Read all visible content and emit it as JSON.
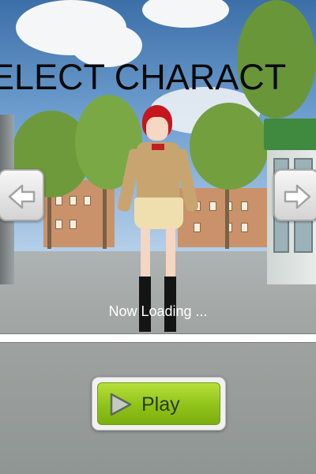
{
  "screen": {
    "title": "ELECT CHARACT",
    "status_text": "Now Loading ...",
    "play_label": "Play",
    "loading_progress": 0.0
  },
  "icons": {
    "left_arrow": "arrow-left-icon",
    "right_arrow": "arrow-right-icon",
    "play": "play-triangle-icon"
  },
  "colors": {
    "play_button": "#8fc319",
    "arrow_button": "#e5e5e5",
    "title_text": "#0a0a0a",
    "loading_text": "#ffffff"
  }
}
